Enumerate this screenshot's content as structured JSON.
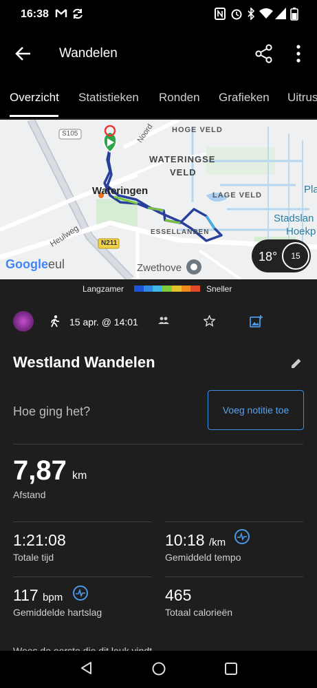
{
  "status_bar": {
    "time": "16:38"
  },
  "app_bar": {
    "title": "Wandelen"
  },
  "tabs": [
    {
      "label": "Overzicht"
    },
    {
      "label": "Statistieken"
    },
    {
      "label": "Ronden"
    },
    {
      "label": "Grafieken"
    },
    {
      "label": "Uitrus"
    }
  ],
  "map": {
    "labels": {
      "road_s105": "S105",
      "noord": "Noord",
      "hoge_veld": "HOGE VELD",
      "wateringse_veld_1": "WATERINGSE",
      "wateringse_veld_2": "VELD",
      "wateringen": "Wateringen",
      "lage_veld": "LAGE VELD",
      "pla": "Pla",
      "stadslan": "Stadslan",
      "hoekp": "Hoekp",
      "heulweg": "Heulweg",
      "essellanden": "ESSELLANDEN",
      "road_n211": "N211",
      "zwethove": "Zwethove",
      "google": "Google",
      "eul": "eul"
    },
    "weather": {
      "temperature": "18°",
      "wind": "15"
    }
  },
  "legend": {
    "slower": "Langzamer",
    "faster": "Sneller",
    "colors": [
      "#1e54d8",
      "#2f8ae6",
      "#3fb7e8",
      "#7ccc3c",
      "#e6c22a",
      "#f08a1e",
      "#e2482a"
    ]
  },
  "activity": {
    "date": "15 apr. @ 14:01",
    "title": "Westland Wandelen",
    "feel_question": "Hoe ging het?",
    "note_button": "Voeg notitie toe"
  },
  "distance": {
    "value": "7,87",
    "unit": "km",
    "label": "Afstand"
  },
  "stats": {
    "total_time": {
      "value": "1:21:08",
      "label": "Totale tijd"
    },
    "pace": {
      "value": "10:18",
      "unit": "/km",
      "label": "Gemiddeld tempo"
    },
    "heart_rate": {
      "value": "117",
      "unit": "bpm",
      "label": "Gemiddelde hartslag"
    },
    "calories": {
      "value": "465",
      "label": "Totaal calorieën"
    }
  },
  "cut_off_text": "Wees de eerste die dit leuk vindt",
  "icons": {
    "status": [
      "gmail-icon",
      "sync-icon",
      "nfc-icon",
      "alarm-icon",
      "bluetooth-icon",
      "wifi-icon",
      "signal-icon",
      "battery-icon"
    ]
  }
}
